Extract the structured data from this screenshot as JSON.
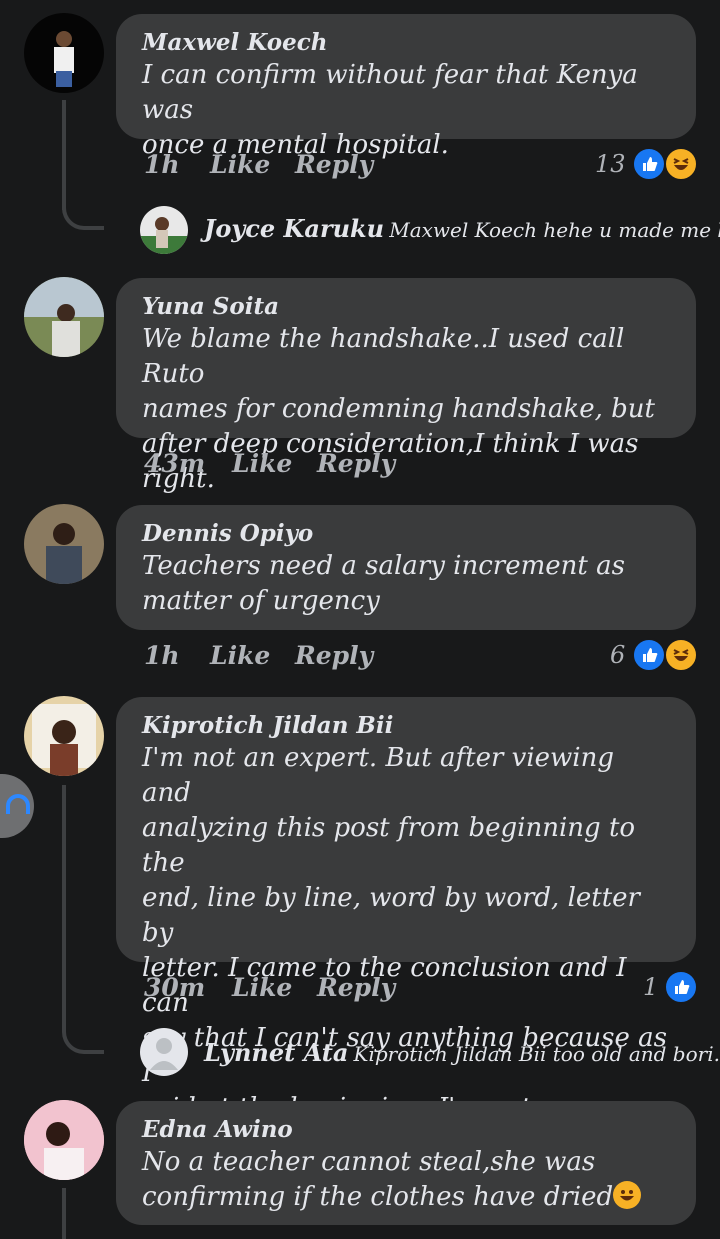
{
  "comments": [
    {
      "author": "Maxwel Koech",
      "text": "I can confirm without fear that Kenya was\nonce a mental hospital.",
      "time": "1h",
      "like": "Like",
      "reply": "Reply",
      "reactions": "13"
    },
    {
      "author": "Yuna Soita",
      "text": "We blame the handshake..I used call Ruto\nnames for  condemning handshake, but\nafter deep consideration,I think I was right.",
      "time": "43m",
      "like": "Like",
      "reply": "Reply"
    },
    {
      "author": "Dennis Opiyo",
      "text": "Teachers need a salary increment as\nmatter of urgency",
      "time": "1h",
      "like": "Like",
      "reply": "Reply",
      "reactions": "6"
    },
    {
      "author": "Kiprotich Jildan Bii",
      "text": "I'm not an expert. But after viewing and\nanalyzing this post from beginning to the\nend, line by line, word by word, letter by\nletter. I came to the conclusion and I can\nsay that I can't say anything because as I\nsaid at the beginning, I'm not an expert.",
      "time": "30m",
      "like": "Like",
      "reply": "Reply",
      "reactions": "1"
    },
    {
      "author": "Edna Awino",
      "text": "No a teacher cannot steal,she was\nconfirming if the clothes have dried"
    }
  ],
  "replies": [
    {
      "name": "Joyce Karuku",
      "preview": "Maxwel Koech hehe u made me l..."
    },
    {
      "name": "Lynnet Ata",
      "preview": "Kiprotich Jildan Bii too old and bori..."
    }
  ],
  "colors": {
    "background": "#18191a",
    "bubble": "#3a3b3c",
    "like": "#1877f2",
    "haha": "#f7b125"
  },
  "icons": [
    "like-reaction-icon",
    "haha-reaction-icon",
    "grinning-emoji-icon",
    "headphones-icon"
  ]
}
